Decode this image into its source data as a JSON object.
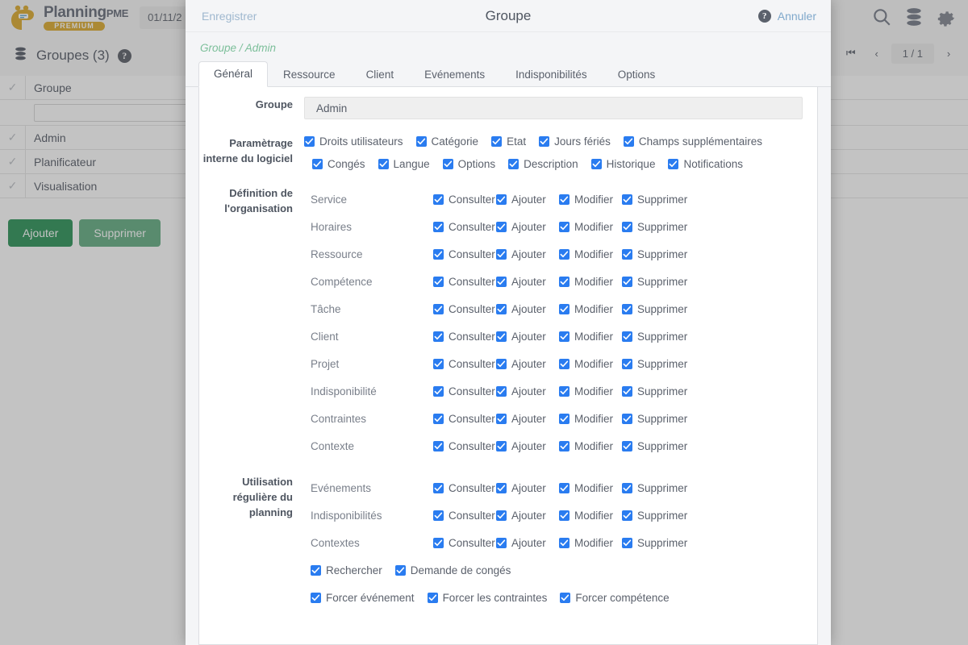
{
  "app": {
    "logo_title": "Planning",
    "logo_title_small": "PME",
    "logo_badge": "PREMIUM",
    "date_value": "01/11/2",
    "subbar_title": "Groupes (3)",
    "pager": {
      "first": "⏮",
      "prev": "‹",
      "count": "1 / 1",
      "next": "›"
    },
    "icons": {
      "search": "search-icon",
      "database": "database-icon",
      "gear": "gear-icon"
    }
  },
  "grid": {
    "header": "Groupe",
    "filter_value": "",
    "rows": [
      "Admin",
      "Planificateur",
      "Visualisation"
    ],
    "add_label": "Ajouter",
    "delete_label": "Supprimer"
  },
  "modal": {
    "save_label": "Enregistrer",
    "title": "Groupe",
    "cancel_label": "Annuler",
    "help_glyph": "?",
    "breadcrumb": "Groupe / Admin",
    "tabs": [
      {
        "label": "Général",
        "active": true
      },
      {
        "label": "Ressource",
        "active": false
      },
      {
        "label": "Client",
        "active": false
      },
      {
        "label": "Evénements",
        "active": false
      },
      {
        "label": "Indisponibilités",
        "active": false
      },
      {
        "label": "Options",
        "active": false
      }
    ],
    "group_field": {
      "label": "Groupe",
      "value": "Admin"
    },
    "internal_settings": {
      "label": "Paramètrage interne du logiciel",
      "line1": [
        {
          "label": "Droits utilisateurs",
          "checked": true
        },
        {
          "label": "Catégorie",
          "checked": true
        },
        {
          "label": "Etat",
          "checked": true
        },
        {
          "label": "Jours fériés",
          "checked": true
        },
        {
          "label": "Champs supplémentaires",
          "checked": true
        }
      ],
      "line2": [
        {
          "label": "Congés",
          "checked": true
        },
        {
          "label": "Langue",
          "checked": true
        },
        {
          "label": "Options",
          "checked": true
        },
        {
          "label": "Description",
          "checked": true
        },
        {
          "label": "Historique",
          "checked": true
        },
        {
          "label": "Notifications",
          "checked": true
        }
      ]
    },
    "organisation": {
      "label": "Définition de l'organisation",
      "actions": [
        "Consulter",
        "Ajouter",
        "Modifier",
        "Supprimer"
      ],
      "rows": [
        {
          "name": "Service",
          "perms": [
            true,
            true,
            true,
            true
          ]
        },
        {
          "name": "Horaires",
          "perms": [
            true,
            true,
            true,
            true
          ]
        },
        {
          "name": "Ressource",
          "perms": [
            true,
            true,
            true,
            true
          ]
        },
        {
          "name": "Compétence",
          "perms": [
            true,
            true,
            true,
            true
          ]
        },
        {
          "name": "Tâche",
          "perms": [
            true,
            true,
            true,
            true
          ]
        },
        {
          "name": "Client",
          "perms": [
            true,
            true,
            true,
            true
          ]
        },
        {
          "name": "Projet",
          "perms": [
            true,
            true,
            true,
            true
          ]
        },
        {
          "name": "Indisponibilité",
          "perms": [
            true,
            true,
            true,
            true
          ]
        },
        {
          "name": "Contraintes",
          "perms": [
            true,
            true,
            true,
            true
          ]
        },
        {
          "name": "Contexte",
          "perms": [
            true,
            true,
            true,
            true
          ]
        }
      ]
    },
    "planning_usage": {
      "label": "Utilisation régulière du planning",
      "actions": [
        "Consulter",
        "Ajouter",
        "Modifier",
        "Supprimer"
      ],
      "rows": [
        {
          "name": "Evénements",
          "perms": [
            true,
            true,
            true,
            true
          ]
        },
        {
          "name": "Indisponibilités",
          "perms": [
            true,
            true,
            true,
            true
          ]
        },
        {
          "name": "Contextes",
          "perms": [
            true,
            true,
            true,
            true
          ]
        }
      ],
      "extra_line1": [
        {
          "label": "Rechercher",
          "checked": true
        },
        {
          "label": "Demande de congés",
          "checked": true
        }
      ],
      "extra_line2": [
        {
          "label": "Forcer événement",
          "checked": true
        },
        {
          "label": "Forcer les contraintes",
          "checked": true
        },
        {
          "label": "Forcer compétence",
          "checked": true
        }
      ]
    }
  },
  "colors": {
    "accent_blue": "#2a7cf0",
    "link_blue": "#7fa8cb",
    "breadcrumb_green": "#7cbf9a",
    "button_green": "#1f8b4d",
    "logo_gold": "#d9a520"
  }
}
